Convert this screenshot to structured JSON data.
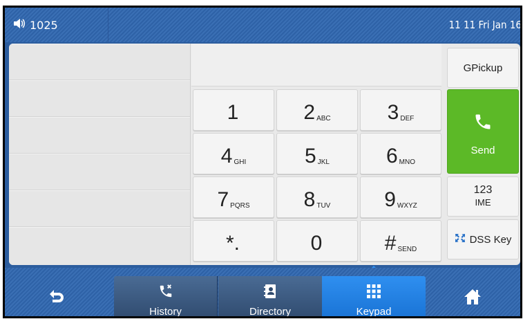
{
  "status": {
    "account": "1025",
    "datetime": "11 11 Fri Jan 16",
    "icons": {
      "volume": "speaker-icon"
    }
  },
  "dialer": {
    "input_value": "",
    "keys": [
      {
        "num": "1",
        "sub": ""
      },
      {
        "num": "2",
        "sub": "ABC"
      },
      {
        "num": "3",
        "sub": "DEF"
      },
      {
        "num": "4",
        "sub": "GHI"
      },
      {
        "num": "5",
        "sub": "JKL"
      },
      {
        "num": "6",
        "sub": "MNO"
      },
      {
        "num": "7",
        "sub": "PQRS"
      },
      {
        "num": "8",
        "sub": "TUV"
      },
      {
        "num": "9",
        "sub": "WXYZ"
      },
      {
        "num": "*.",
        "sub": ""
      },
      {
        "num": "0",
        "sub": ""
      },
      {
        "num": "#",
        "sub": "SEND"
      }
    ]
  },
  "side_buttons": {
    "gpickup": "GPickup",
    "send": "Send",
    "ime_top": "123",
    "ime_bottom": "IME",
    "dss_key": "DSS Key"
  },
  "tabs": {
    "history": "History",
    "directory": "Directory",
    "keypad": "Keypad"
  },
  "colors": {
    "send_green": "#5cb927",
    "active_tab": "#1f7fe0",
    "bar_blue": "#3366aa"
  }
}
